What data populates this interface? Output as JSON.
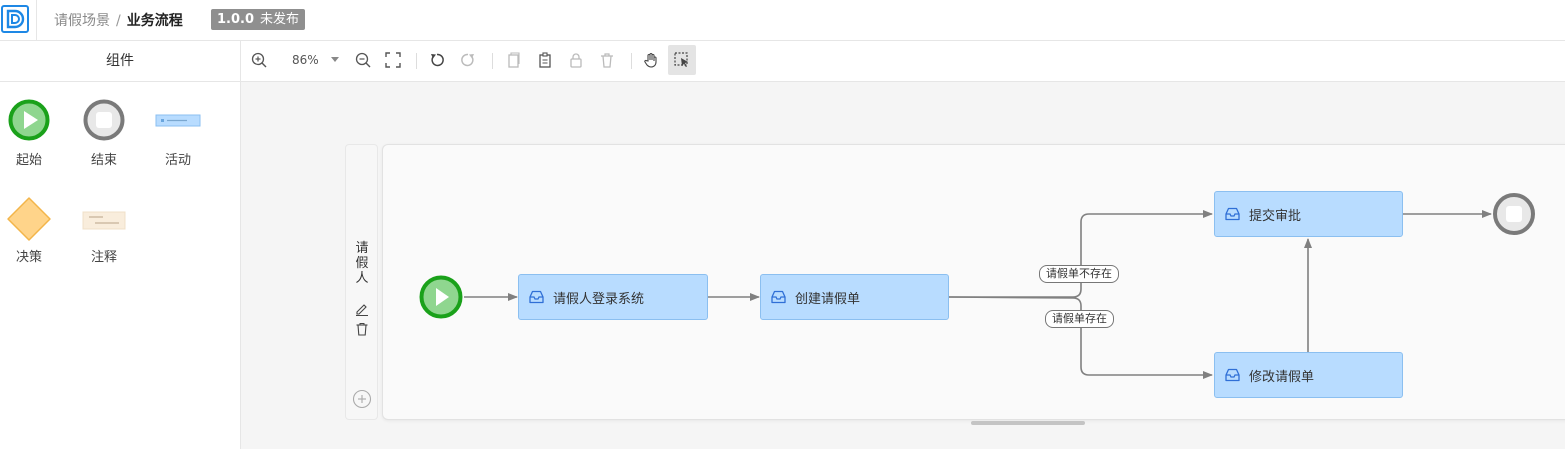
{
  "header": {
    "scene": "请假场景",
    "separator": "/",
    "current": "业务流程",
    "version": "1.0.0",
    "status": "未发布"
  },
  "sidebar": {
    "title": "组件",
    "items": [
      {
        "label": "起始",
        "icon": "start-event-icon"
      },
      {
        "label": "结束",
        "icon": "end-event-icon"
      },
      {
        "label": "活动",
        "icon": "activity-icon"
      },
      {
        "label": "决策",
        "icon": "decision-icon"
      },
      {
        "label": "注释",
        "icon": "annotation-icon"
      }
    ]
  },
  "toolbar": {
    "zoom": "86%",
    "tools": [
      "zoom-in-icon",
      "zoom-dropdown-icon",
      "zoom-out-icon",
      "fit-screen-icon",
      "undo-icon",
      "redo-icon",
      "copy-icon",
      "paste-icon",
      "lock-icon",
      "delete-icon",
      "hand-tool-icon",
      "select-tool-icon"
    ],
    "active_tool": "select-tool-icon"
  },
  "canvas": {
    "lane": {
      "name": "请假人"
    },
    "tasks": [
      {
        "id": "login",
        "label": "请假人登录系统"
      },
      {
        "id": "create",
        "label": "创建请假单"
      },
      {
        "id": "submit",
        "label": "提交审批"
      },
      {
        "id": "modify",
        "label": "修改请假单"
      }
    ],
    "edge_labels": {
      "not_exists": "请假单不存在",
      "exists": "请假单存在"
    }
  },
  "colors": {
    "start_green": "#1aa11a",
    "task_fill": "#b8dcff",
    "task_border": "#8bbff0",
    "edge": "#808080",
    "badge": "#8f8f8f"
  }
}
